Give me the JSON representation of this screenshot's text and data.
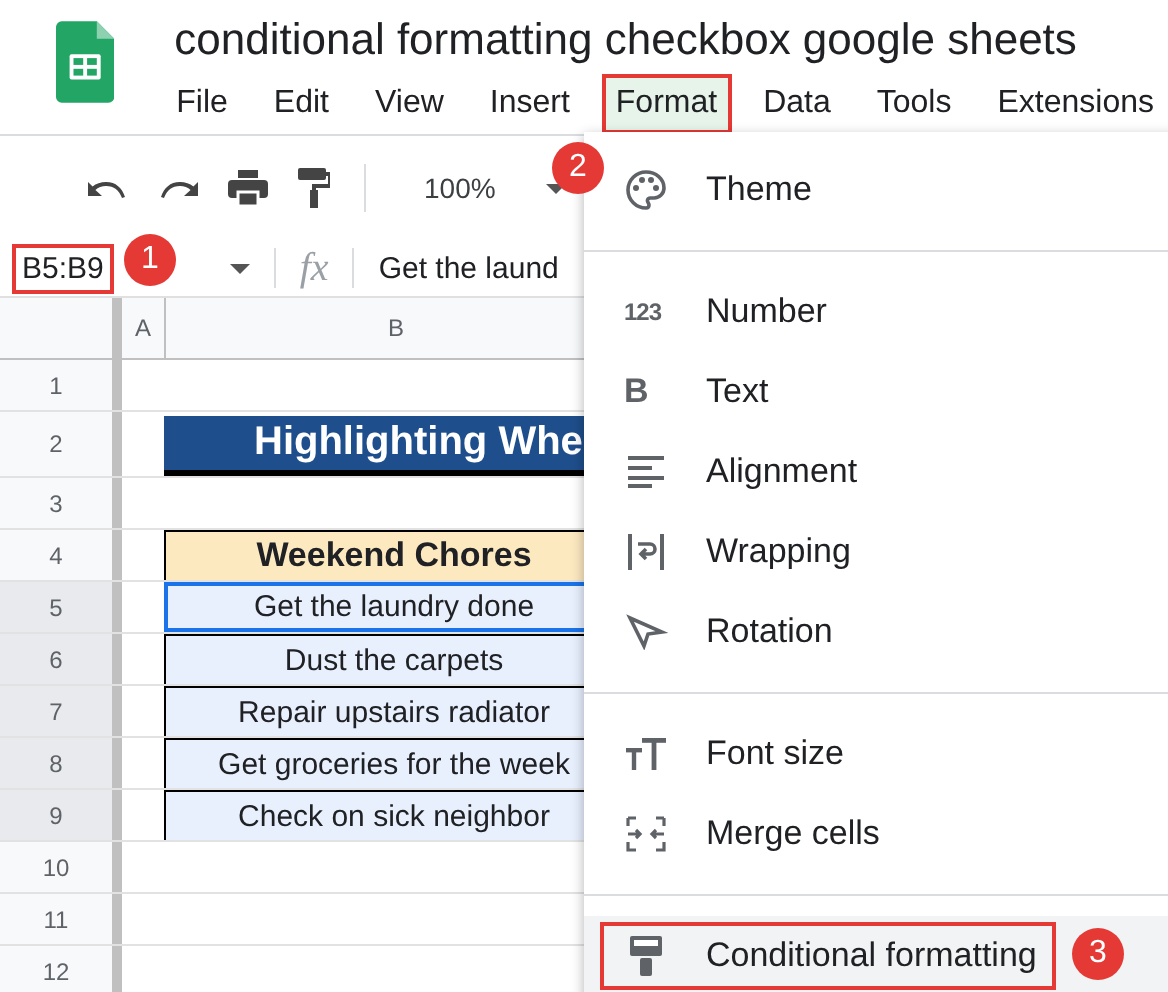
{
  "app": {
    "title": "conditional formatting checkbox google sheets",
    "menus": [
      {
        "label": "File",
        "selected": false
      },
      {
        "label": "Edit",
        "selected": false
      },
      {
        "label": "View",
        "selected": false
      },
      {
        "label": "Insert",
        "selected": false
      },
      {
        "label": "Format",
        "selected": true
      },
      {
        "label": "Data",
        "selected": false
      },
      {
        "label": "Tools",
        "selected": false
      },
      {
        "label": "Extensions",
        "selected": false
      }
    ]
  },
  "toolbar": {
    "zoom": "100%"
  },
  "formula_bar": {
    "name_box": "B5:B9",
    "name_box_outlined": true,
    "fx": "fx",
    "formula": "Get the laund"
  },
  "sheet": {
    "columns": [
      "A",
      "B"
    ],
    "rows": [
      {
        "label": "1",
        "selected": false
      },
      {
        "label": "2",
        "selected": false,
        "cell": {
          "kind": "title",
          "text": "Highlighting Whe"
        }
      },
      {
        "label": "3",
        "selected": false
      },
      {
        "label": "4",
        "selected": false,
        "cell": {
          "kind": "header",
          "text": "Weekend Chores"
        }
      },
      {
        "label": "5",
        "selected": true,
        "cell": {
          "kind": "item",
          "text": "Get the laundry done",
          "active": true
        }
      },
      {
        "label": "6",
        "selected": true,
        "cell": {
          "kind": "item",
          "text": "Dust the carpets",
          "active": false
        }
      },
      {
        "label": "7",
        "selected": true,
        "cell": {
          "kind": "item",
          "text": "Repair upstairs radiator",
          "active": false
        }
      },
      {
        "label": "8",
        "selected": true,
        "cell": {
          "kind": "item",
          "text": "Get groceries for the week",
          "active": false
        }
      },
      {
        "label": "9",
        "selected": true,
        "cell": {
          "kind": "item",
          "text": "Check on sick neighbor",
          "active": false
        }
      },
      {
        "label": "10",
        "selected": false
      },
      {
        "label": "11",
        "selected": false
      },
      {
        "label": "12",
        "selected": false
      }
    ]
  },
  "format_menu": {
    "items": [
      {
        "kind": "item",
        "label": "Theme",
        "highlighted": false
      },
      {
        "kind": "divider"
      },
      {
        "kind": "item",
        "label": "Number",
        "icon_text": "123",
        "highlighted": false
      },
      {
        "kind": "item",
        "label": "Text",
        "icon_text": "B",
        "highlighted": false
      },
      {
        "kind": "item",
        "label": "Alignment",
        "highlighted": false
      },
      {
        "kind": "item",
        "label": "Wrapping",
        "highlighted": false
      },
      {
        "kind": "item",
        "label": "Rotation",
        "highlighted": false
      },
      {
        "kind": "divider"
      },
      {
        "kind": "item",
        "label": "Font size",
        "highlighted": false
      },
      {
        "kind": "item",
        "label": "Merge cells",
        "highlighted": false
      },
      {
        "kind": "divider"
      },
      {
        "kind": "item",
        "label": "Conditional formatting",
        "highlighted": true
      }
    ]
  },
  "callouts": [
    "1",
    "2",
    "3"
  ]
}
